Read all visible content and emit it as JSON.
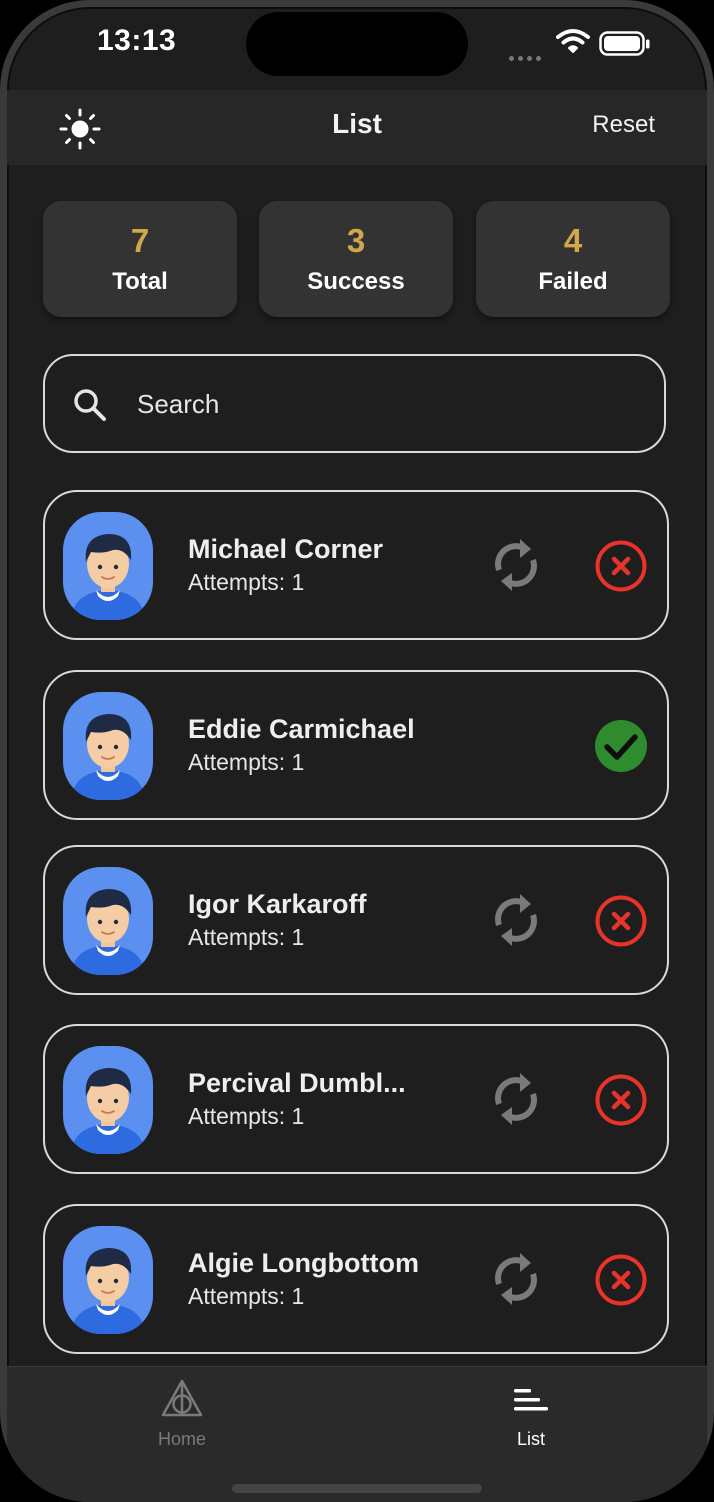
{
  "status_bar": {
    "time": "13:13"
  },
  "header": {
    "title": "List",
    "reset_label": "Reset",
    "theme_icon": "sun-icon"
  },
  "stats": [
    {
      "value": "7",
      "label": "Total"
    },
    {
      "value": "3",
      "label": "Success"
    },
    {
      "value": "4",
      "label": "Failed"
    }
  ],
  "search": {
    "placeholder": "Search",
    "value": ""
  },
  "list": [
    {
      "name": "Michael Corner",
      "attempts": "Attempts: 1",
      "status": "failed",
      "retry": true
    },
    {
      "name": "Eddie Carmichael",
      "attempts": "Attempts: 1",
      "status": "success",
      "retry": false
    },
    {
      "name": "Igor Karkaroff",
      "attempts": "Attempts: 1",
      "status": "failed",
      "retry": true
    },
    {
      "name": "Percival Dumbl...",
      "attempts": "Attempts: 1",
      "status": "failed",
      "retry": true
    },
    {
      "name": "Algie Longbottom",
      "attempts": "Attempts: 1",
      "status": "failed",
      "retry": true
    }
  ],
  "bottom_nav": [
    {
      "label": "Home",
      "icon": "deathly-hallows-icon",
      "active": false
    },
    {
      "label": "List",
      "icon": "list-icon",
      "active": true
    }
  ],
  "colors": {
    "background": "#1e1e1e",
    "accent": "#d0a849",
    "success": "#2e8b2e",
    "failed": "#e8332a",
    "inactive": "#7a7a7a"
  }
}
